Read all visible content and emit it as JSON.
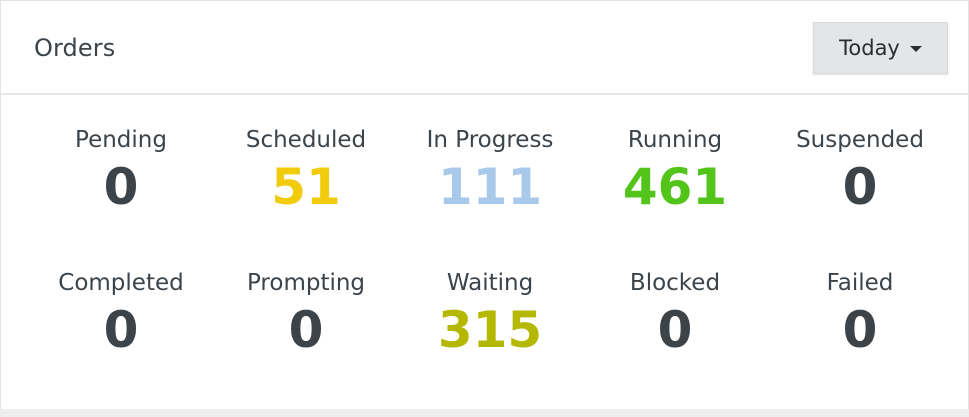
{
  "panel": {
    "title": "Orders",
    "range_selector": {
      "label": "Today",
      "icon": "caret-down-icon"
    }
  },
  "stats": [
    {
      "label": "Pending",
      "value": "0",
      "color": "#3d4449"
    },
    {
      "label": "Scheduled",
      "value": "51",
      "color": "#f2cc0c"
    },
    {
      "label": "In Progress",
      "value": "111",
      "color": "#a9c9ea"
    },
    {
      "label": "Running",
      "value": "461",
      "color": "#52c41a"
    },
    {
      "label": "Suspended",
      "value": "0",
      "color": "#3d4449"
    },
    {
      "label": "Completed",
      "value": "0",
      "color": "#3d4449"
    },
    {
      "label": "Prompting",
      "value": "0",
      "color": "#3d4449"
    },
    {
      "label": "Waiting",
      "value": "315",
      "color": "#b5b800"
    },
    {
      "label": "Blocked",
      "value": "0",
      "color": "#3d4449"
    },
    {
      "label": "Failed",
      "value": "0",
      "color": "#3d4449"
    }
  ]
}
